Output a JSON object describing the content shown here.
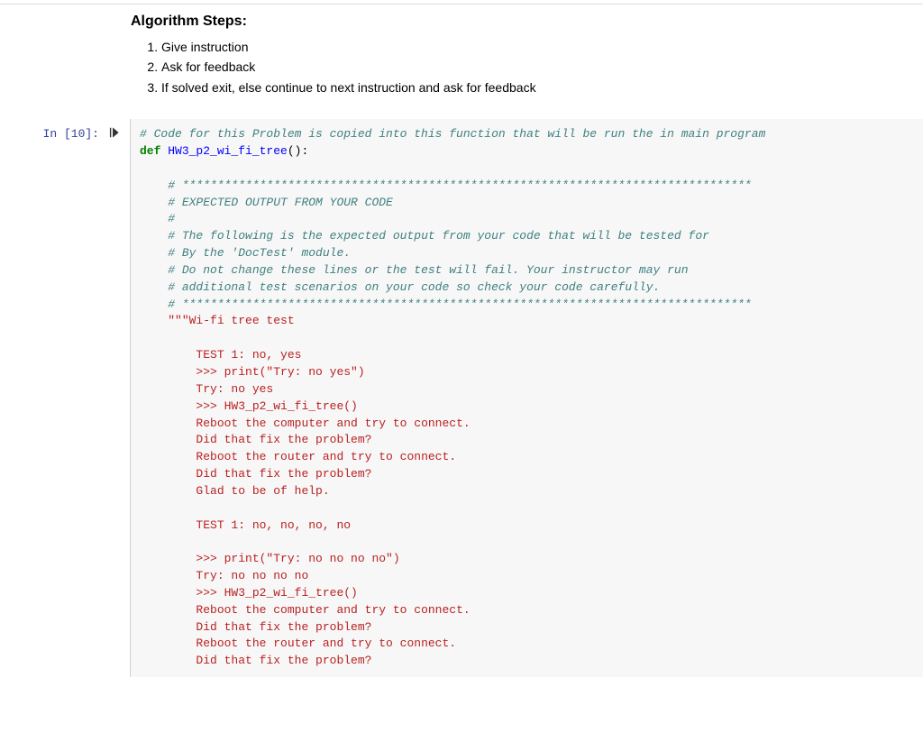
{
  "text": {
    "heading": "Algorithm Steps:",
    "steps": [
      "Give instruction",
      "Ask for feedback",
      "If solved exit, else continue to next instruction and ask for feedback"
    ]
  },
  "cell": {
    "prompt": "In [10]:",
    "code_comment_line": "# Code for this Problem is copied into this function that will be run the in main program",
    "def_keyword": "def",
    "func_name": "HW3_p2_wi_fi_tree",
    "func_suffix": "():",
    "body_comments": [
      "# *********************************************************************************",
      "# EXPECTED OUTPUT FROM YOUR CODE",
      "#",
      "# The following is the expected output from your code that will be tested for",
      "# By the 'DocTest' module.",
      "# Do not change these lines or the test will fail. Your instructor may run",
      "# additional test scenarios on your code so check your code carefully.",
      "# *********************************************************************************"
    ],
    "docstring": [
      "\"\"\"Wi-fi tree test",
      "",
      "    TEST 1: no, yes",
      "    >>> print(\"Try: no yes\")",
      "    Try: no yes",
      "    >>> HW3_p2_wi_fi_tree()",
      "    Reboot the computer and try to connect.",
      "    Did that fix the problem?",
      "    Reboot the router and try to connect.",
      "    Did that fix the problem?",
      "    Glad to be of help.",
      "",
      "    TEST 1: no, no, no, no",
      "",
      "    >>> print(\"Try: no no no no\")",
      "    Try: no no no no",
      "    >>> HW3_p2_wi_fi_tree()",
      "    Reboot the computer and try to connect.",
      "    Did that fix the problem?",
      "    Reboot the router and try to connect.",
      "    Did that fix the problem?"
    ]
  }
}
